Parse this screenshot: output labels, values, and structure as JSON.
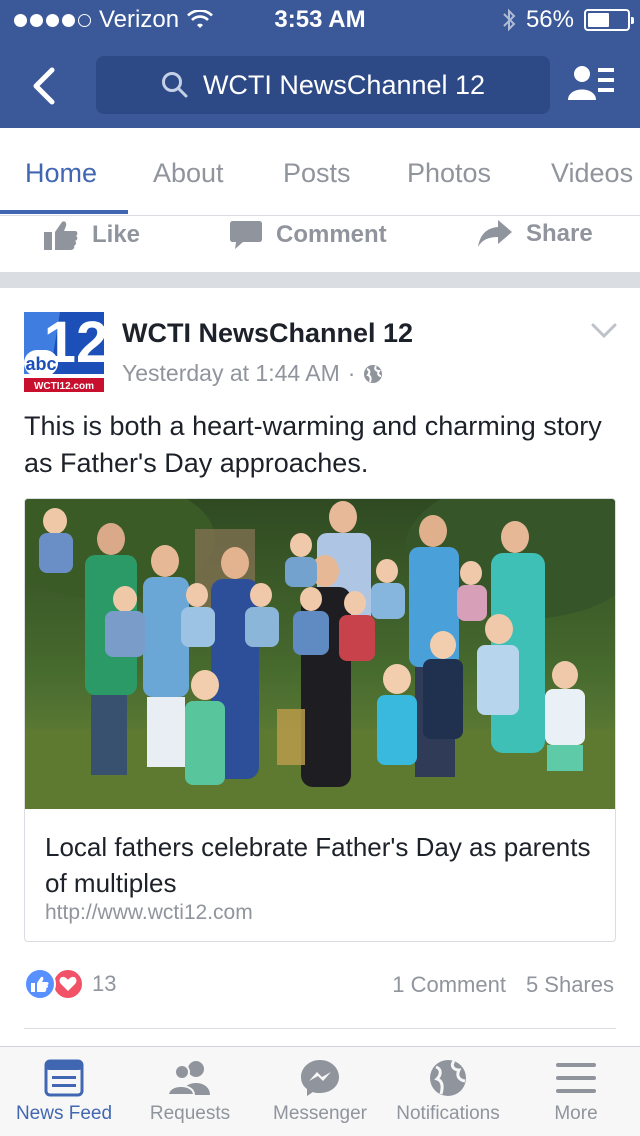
{
  "status_bar": {
    "carrier": "Verizon",
    "time": "3:53 AM",
    "battery": "56%",
    "battery_level": 0.56
  },
  "nav": {
    "search_text": "WCTI NewsChannel 12",
    "back_icon": "chevron-left-icon",
    "profile_icon": "profile-list-icon"
  },
  "tabs": [
    "Home",
    "About",
    "Posts",
    "Photos",
    "Videos"
  ],
  "prev_actions": {
    "like": "Like",
    "comment": "Comment",
    "share": "Share"
  },
  "post": {
    "page_name": "WCTI NewsChannel 12",
    "timestamp": "Yesterday at 1:44 AM",
    "meta_separator": "·",
    "text": "This is both a heart-warming and charming story as Father's Day approaches.",
    "avatar_logo": {
      "number": "12",
      "network": "abc",
      "site": "WCTI12.com"
    },
    "link": {
      "title": "Local fathers celebrate Father's Day as parents of multiples",
      "url": "http://www.wcti12.com"
    },
    "reaction_count": "13",
    "comments": "1 Comment",
    "shares": "5 Shares"
  },
  "bottom_tabs": {
    "news_feed": "News Feed",
    "requests": "Requests",
    "messenger": "Messenger",
    "notifications": "Notifications",
    "more": "More"
  },
  "colors": {
    "brand": "#3b5998",
    "search_bg": "#2d4a86",
    "active": "#4267b2",
    "muted": "#90949c",
    "like": "#5890ff",
    "love": "#f25268"
  }
}
